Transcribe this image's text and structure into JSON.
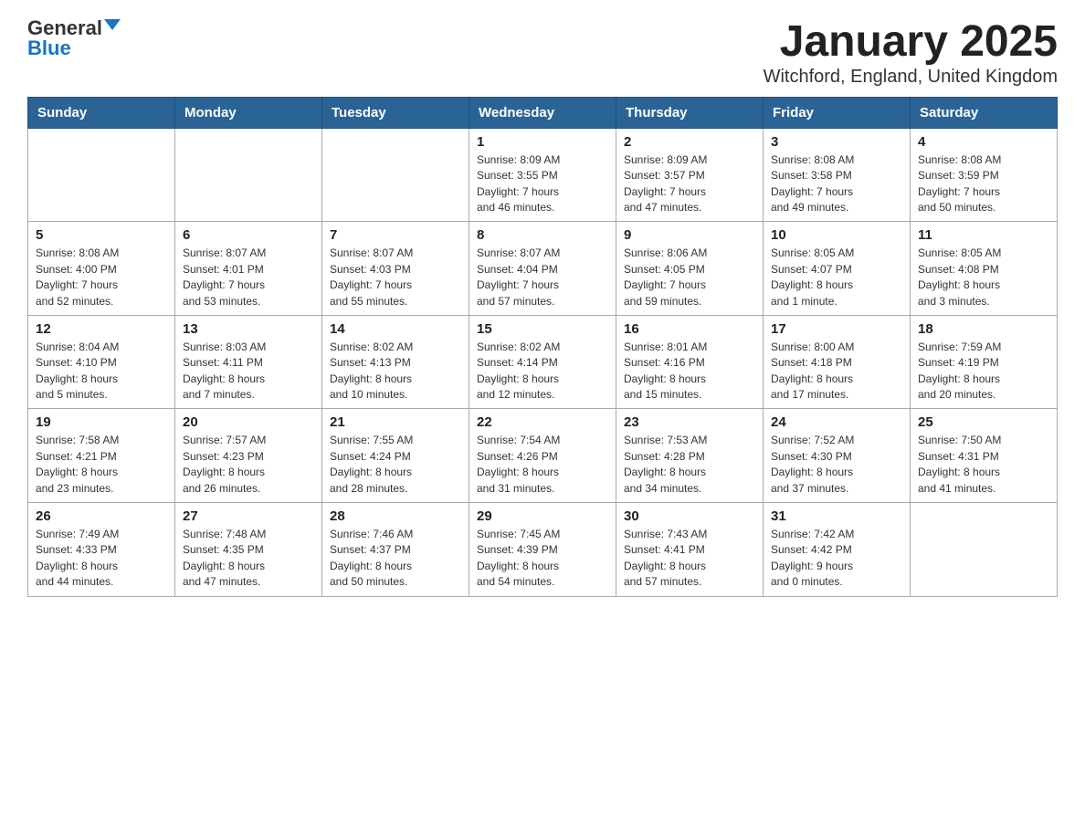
{
  "logo": {
    "text_general": "General",
    "text_blue": "Blue"
  },
  "title": "January 2025",
  "subtitle": "Witchford, England, United Kingdom",
  "days_of_week": [
    "Sunday",
    "Monday",
    "Tuesday",
    "Wednesday",
    "Thursday",
    "Friday",
    "Saturday"
  ],
  "weeks": [
    [
      {
        "day": "",
        "info": ""
      },
      {
        "day": "",
        "info": ""
      },
      {
        "day": "",
        "info": ""
      },
      {
        "day": "1",
        "info": "Sunrise: 8:09 AM\nSunset: 3:55 PM\nDaylight: 7 hours\nand 46 minutes."
      },
      {
        "day": "2",
        "info": "Sunrise: 8:09 AM\nSunset: 3:57 PM\nDaylight: 7 hours\nand 47 minutes."
      },
      {
        "day": "3",
        "info": "Sunrise: 8:08 AM\nSunset: 3:58 PM\nDaylight: 7 hours\nand 49 minutes."
      },
      {
        "day": "4",
        "info": "Sunrise: 8:08 AM\nSunset: 3:59 PM\nDaylight: 7 hours\nand 50 minutes."
      }
    ],
    [
      {
        "day": "5",
        "info": "Sunrise: 8:08 AM\nSunset: 4:00 PM\nDaylight: 7 hours\nand 52 minutes."
      },
      {
        "day": "6",
        "info": "Sunrise: 8:07 AM\nSunset: 4:01 PM\nDaylight: 7 hours\nand 53 minutes."
      },
      {
        "day": "7",
        "info": "Sunrise: 8:07 AM\nSunset: 4:03 PM\nDaylight: 7 hours\nand 55 minutes."
      },
      {
        "day": "8",
        "info": "Sunrise: 8:07 AM\nSunset: 4:04 PM\nDaylight: 7 hours\nand 57 minutes."
      },
      {
        "day": "9",
        "info": "Sunrise: 8:06 AM\nSunset: 4:05 PM\nDaylight: 7 hours\nand 59 minutes."
      },
      {
        "day": "10",
        "info": "Sunrise: 8:05 AM\nSunset: 4:07 PM\nDaylight: 8 hours\nand 1 minute."
      },
      {
        "day": "11",
        "info": "Sunrise: 8:05 AM\nSunset: 4:08 PM\nDaylight: 8 hours\nand 3 minutes."
      }
    ],
    [
      {
        "day": "12",
        "info": "Sunrise: 8:04 AM\nSunset: 4:10 PM\nDaylight: 8 hours\nand 5 minutes."
      },
      {
        "day": "13",
        "info": "Sunrise: 8:03 AM\nSunset: 4:11 PM\nDaylight: 8 hours\nand 7 minutes."
      },
      {
        "day": "14",
        "info": "Sunrise: 8:02 AM\nSunset: 4:13 PM\nDaylight: 8 hours\nand 10 minutes."
      },
      {
        "day": "15",
        "info": "Sunrise: 8:02 AM\nSunset: 4:14 PM\nDaylight: 8 hours\nand 12 minutes."
      },
      {
        "day": "16",
        "info": "Sunrise: 8:01 AM\nSunset: 4:16 PM\nDaylight: 8 hours\nand 15 minutes."
      },
      {
        "day": "17",
        "info": "Sunrise: 8:00 AM\nSunset: 4:18 PM\nDaylight: 8 hours\nand 17 minutes."
      },
      {
        "day": "18",
        "info": "Sunrise: 7:59 AM\nSunset: 4:19 PM\nDaylight: 8 hours\nand 20 minutes."
      }
    ],
    [
      {
        "day": "19",
        "info": "Sunrise: 7:58 AM\nSunset: 4:21 PM\nDaylight: 8 hours\nand 23 minutes."
      },
      {
        "day": "20",
        "info": "Sunrise: 7:57 AM\nSunset: 4:23 PM\nDaylight: 8 hours\nand 26 minutes."
      },
      {
        "day": "21",
        "info": "Sunrise: 7:55 AM\nSunset: 4:24 PM\nDaylight: 8 hours\nand 28 minutes."
      },
      {
        "day": "22",
        "info": "Sunrise: 7:54 AM\nSunset: 4:26 PM\nDaylight: 8 hours\nand 31 minutes."
      },
      {
        "day": "23",
        "info": "Sunrise: 7:53 AM\nSunset: 4:28 PM\nDaylight: 8 hours\nand 34 minutes."
      },
      {
        "day": "24",
        "info": "Sunrise: 7:52 AM\nSunset: 4:30 PM\nDaylight: 8 hours\nand 37 minutes."
      },
      {
        "day": "25",
        "info": "Sunrise: 7:50 AM\nSunset: 4:31 PM\nDaylight: 8 hours\nand 41 minutes."
      }
    ],
    [
      {
        "day": "26",
        "info": "Sunrise: 7:49 AM\nSunset: 4:33 PM\nDaylight: 8 hours\nand 44 minutes."
      },
      {
        "day": "27",
        "info": "Sunrise: 7:48 AM\nSunset: 4:35 PM\nDaylight: 8 hours\nand 47 minutes."
      },
      {
        "day": "28",
        "info": "Sunrise: 7:46 AM\nSunset: 4:37 PM\nDaylight: 8 hours\nand 50 minutes."
      },
      {
        "day": "29",
        "info": "Sunrise: 7:45 AM\nSunset: 4:39 PM\nDaylight: 8 hours\nand 54 minutes."
      },
      {
        "day": "30",
        "info": "Sunrise: 7:43 AM\nSunset: 4:41 PM\nDaylight: 8 hours\nand 57 minutes."
      },
      {
        "day": "31",
        "info": "Sunrise: 7:42 AM\nSunset: 4:42 PM\nDaylight: 9 hours\nand 0 minutes."
      },
      {
        "day": "",
        "info": ""
      }
    ]
  ]
}
